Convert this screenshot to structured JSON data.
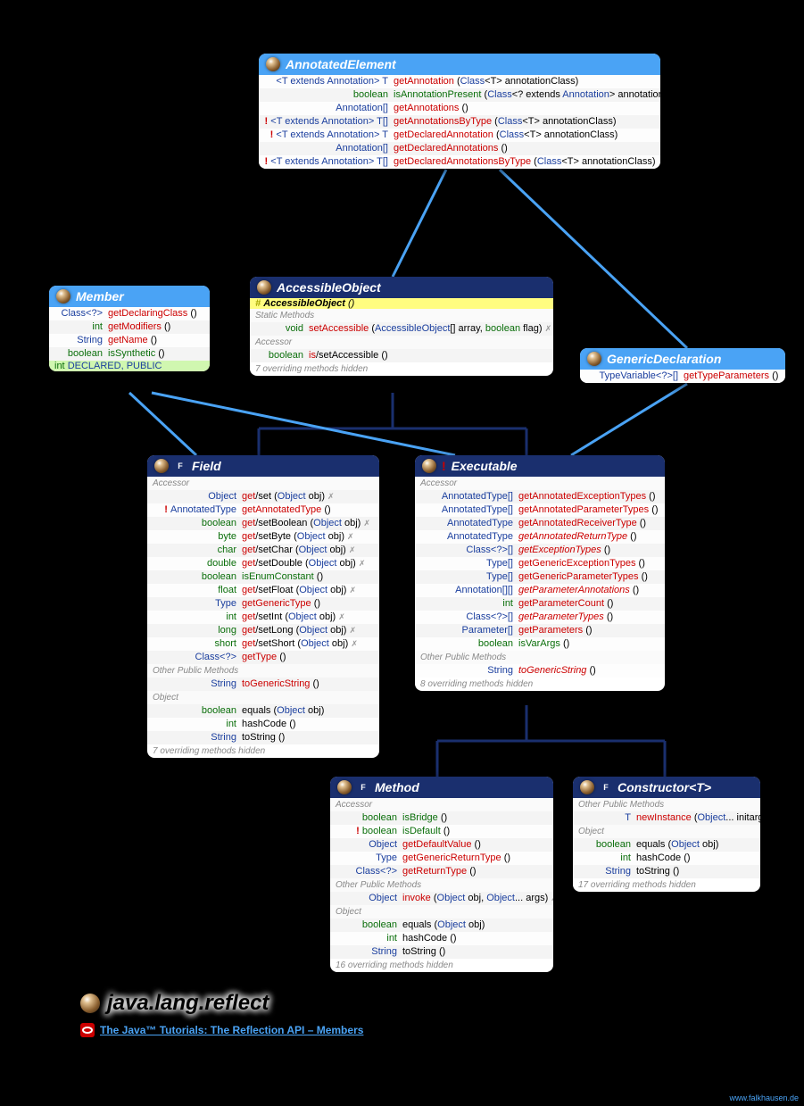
{
  "footer": {
    "package": "java.lang.reflect",
    "tutorial_link": "The Java™ Tutorials: The Reflection API – Members",
    "credit": "www.falkhausen.de"
  },
  "boxes": {
    "AnnotatedElement": {
      "title": "AnnotatedElement",
      "rows": [
        {
          "ret": "<T extends Annotation> T",
          "name": "getAnnotation",
          "params": "(Class<T> annotationClass)"
        },
        {
          "ret": "boolean",
          "ret_style": "green",
          "name": "isAnnotationPresent",
          "name_style": "green",
          "params": "(Class<? extends Annotation> annotationClass)"
        },
        {
          "ret": "Annotation[]",
          "name": "getAnnotations",
          "params": "()"
        },
        {
          "prefix": "!",
          "ret": "<T extends Annotation> T[]",
          "name": "getAnnotationsByType",
          "params": "(Class<T> annotationClass)"
        },
        {
          "prefix": "!",
          "ret": "<T extends Annotation> T",
          "name": "getDeclaredAnnotation",
          "params": "(Class<T> annotationClass)"
        },
        {
          "ret": "Annotation[]",
          "name": "getDeclaredAnnotations",
          "params": "()"
        },
        {
          "prefix": "!",
          "ret": "<T extends Annotation> T[]",
          "name": "getDeclaredAnnotationsByType",
          "params": "(Class<T> annotationClass)"
        }
      ]
    },
    "Member": {
      "title": "Member",
      "rows": [
        {
          "ret": "Class<?>",
          "name": "getDeclaringClass",
          "params": "()"
        },
        {
          "ret": "int",
          "ret_style": "green",
          "name": "getModifiers",
          "params": "()"
        },
        {
          "ret": "String",
          "name": "getName",
          "params": "()"
        },
        {
          "ret": "boolean",
          "ret_style": "green",
          "name": "isSynthetic",
          "name_style": "green",
          "params": "()"
        }
      ],
      "const": "int DECLARED, PUBLIC"
    },
    "AccessibleObject": {
      "title": "AccessibleObject",
      "ctor": "# AccessibleObject ()",
      "sections": [
        {
          "label": "Static Methods",
          "rows": [
            {
              "ret": "void",
              "ret_style": "green",
              "name": "setAccessible",
              "params": "(AccessibleObject[] array, boolean flag)",
              "sec": true
            }
          ]
        },
        {
          "label": "Accessor",
          "rows": [
            {
              "ret": "boolean",
              "ret_style": "green",
              "name": "is/setAccessible",
              "name_style": "mixed",
              "params": "()"
            }
          ]
        }
      ],
      "hidden": "7 overriding methods hidden"
    },
    "GenericDeclaration": {
      "title": "GenericDeclaration",
      "rows": [
        {
          "ret": "TypeVariable<?>[]",
          "name": "getTypeParameters",
          "params": "()"
        }
      ]
    },
    "Field": {
      "title": "Field",
      "sections": [
        {
          "label": "Accessor",
          "rows": [
            {
              "ret": "Object",
              "name": "get/set",
              "name_style": "mixed",
              "params": "(Object obj)",
              "sec": true
            },
            {
              "prefix": "!",
              "ret": "AnnotatedType",
              "name": "getAnnotatedType",
              "params": "()"
            },
            {
              "ret": "boolean",
              "ret_style": "green",
              "name": "get/setBoolean",
              "name_style": "mixed",
              "params": "(Object obj)",
              "sec": true
            },
            {
              "ret": "byte",
              "ret_style": "green",
              "name": "get/setByte",
              "name_style": "mixed",
              "params": "(Object obj)",
              "sec": true
            },
            {
              "ret": "char",
              "ret_style": "green",
              "name": "get/setChar",
              "name_style": "mixed",
              "params": "(Object obj)",
              "sec": true
            },
            {
              "ret": "double",
              "ret_style": "green",
              "name": "get/setDouble",
              "name_style": "mixed",
              "params": "(Object obj)",
              "sec": true
            },
            {
              "ret": "boolean",
              "ret_style": "green",
              "name": "isEnumConstant",
              "name_style": "green",
              "params": "()"
            },
            {
              "ret": "float",
              "ret_style": "green",
              "name": "get/setFloat",
              "name_style": "mixed",
              "params": "(Object obj)",
              "sec": true
            },
            {
              "ret": "Type",
              "name": "getGenericType",
              "params": "()"
            },
            {
              "ret": "int",
              "ret_style": "green",
              "name": "get/setInt",
              "name_style": "mixed",
              "params": "(Object obj)",
              "sec": true
            },
            {
              "ret": "long",
              "ret_style": "green",
              "name": "get/setLong",
              "name_style": "mixed",
              "params": "(Object obj)",
              "sec": true
            },
            {
              "ret": "short",
              "ret_style": "green",
              "name": "get/setShort",
              "name_style": "mixed",
              "params": "(Object obj)",
              "sec": true
            },
            {
              "ret": "Class<?>",
              "name": "getType",
              "params": "()"
            }
          ]
        },
        {
          "label": "Other Public Methods",
          "rows": [
            {
              "ret": "String",
              "name": "toGenericString",
              "params": "()"
            }
          ]
        },
        {
          "label": "Object",
          "rows": [
            {
              "ret": "boolean",
              "ret_style": "green",
              "name": "equals",
              "name_style": "black",
              "params": "(Object obj)"
            },
            {
              "ret": "int",
              "ret_style": "green",
              "name": "hashCode",
              "name_style": "black",
              "params": "()"
            },
            {
              "ret": "String",
              "name": "toString",
              "name_style": "black",
              "params": "()"
            }
          ]
        }
      ],
      "hidden": "7 overriding methods hidden"
    },
    "Executable": {
      "title": "Executable",
      "prefix": "!",
      "sections": [
        {
          "label": "Accessor",
          "rows": [
            {
              "ret": "AnnotatedType[]",
              "name": "getAnnotatedExceptionTypes",
              "params": "()"
            },
            {
              "ret": "AnnotatedType[]",
              "name": "getAnnotatedParameterTypes",
              "params": "()"
            },
            {
              "ret": "AnnotatedType",
              "name": "getAnnotatedReceiverType",
              "params": "()"
            },
            {
              "ret": "AnnotatedType",
              "name": "getAnnotatedReturnType",
              "name_style": "ital",
              "params": "()"
            },
            {
              "ret": "Class<?>[]",
              "name": "getExceptionTypes",
              "name_style": "ital",
              "params": "()"
            },
            {
              "ret": "Type[]",
              "name": "getGenericExceptionTypes",
              "params": "()"
            },
            {
              "ret": "Type[]",
              "name": "getGenericParameterTypes",
              "params": "()"
            },
            {
              "ret": "Annotation[][]",
              "name": "getParameterAnnotations",
              "name_style": "ital",
              "params": "()"
            },
            {
              "ret": "int",
              "ret_style": "green",
              "name": "getParameterCount",
              "params": "()"
            },
            {
              "ret": "Class<?>[]",
              "name": "getParameterTypes",
              "name_style": "ital",
              "params": "()"
            },
            {
              "ret": "Parameter[]",
              "name": "getParameters",
              "params": "()"
            },
            {
              "ret": "boolean",
              "ret_style": "green",
              "name": "isVarArgs",
              "name_style": "green",
              "params": "()"
            }
          ]
        },
        {
          "label": "Other Public Methods",
          "rows": [
            {
              "ret": "String",
              "name": "toGenericString",
              "name_style": "ital",
              "params": "()"
            }
          ]
        }
      ],
      "hidden": "8 overriding methods hidden"
    },
    "Method": {
      "title": "Method",
      "sections": [
        {
          "label": "Accessor",
          "rows": [
            {
              "ret": "boolean",
              "ret_style": "green",
              "name": "isBridge",
              "name_style": "green",
              "params": "()"
            },
            {
              "prefix": "!",
              "ret": "boolean",
              "ret_style": "green",
              "name": "isDefault",
              "name_style": "green",
              "params": "()"
            },
            {
              "ret": "Object",
              "name": "getDefaultValue",
              "params": "()"
            },
            {
              "ret": "Type",
              "name": "getGenericReturnType",
              "params": "()"
            },
            {
              "ret": "Class<?>",
              "name": "getReturnType",
              "params": "()"
            }
          ]
        },
        {
          "label": "Other Public Methods",
          "rows": [
            {
              "ret": "Object",
              "name": "invoke",
              "params": "(Object obj, Object... args)",
              "sec": true
            }
          ]
        },
        {
          "label": "Object",
          "rows": [
            {
              "ret": "boolean",
              "ret_style": "green",
              "name": "equals",
              "name_style": "black",
              "params": "(Object obj)"
            },
            {
              "ret": "int",
              "ret_style": "green",
              "name": "hashCode",
              "name_style": "black",
              "params": "()"
            },
            {
              "ret": "String",
              "name": "toString",
              "name_style": "black",
              "params": "()"
            }
          ]
        }
      ],
      "hidden": "16 overriding methods hidden"
    },
    "Constructor": {
      "title": "Constructor<T>",
      "sections": [
        {
          "label": "Other Public Methods",
          "rows": [
            {
              "ret": "T",
              "name": "newInstance",
              "params": "(Object... initargs)",
              "sec": true
            }
          ]
        },
        {
          "label": "Object",
          "rows": [
            {
              "ret": "boolean",
              "ret_style": "green",
              "name": "equals",
              "name_style": "black",
              "params": "(Object obj)"
            },
            {
              "ret": "int",
              "ret_style": "green",
              "name": "hashCode",
              "name_style": "black",
              "params": "()"
            },
            {
              "ret": "String",
              "name": "toString",
              "name_style": "black",
              "params": "()"
            }
          ]
        }
      ],
      "hidden": "17 overriding methods hidden"
    }
  }
}
